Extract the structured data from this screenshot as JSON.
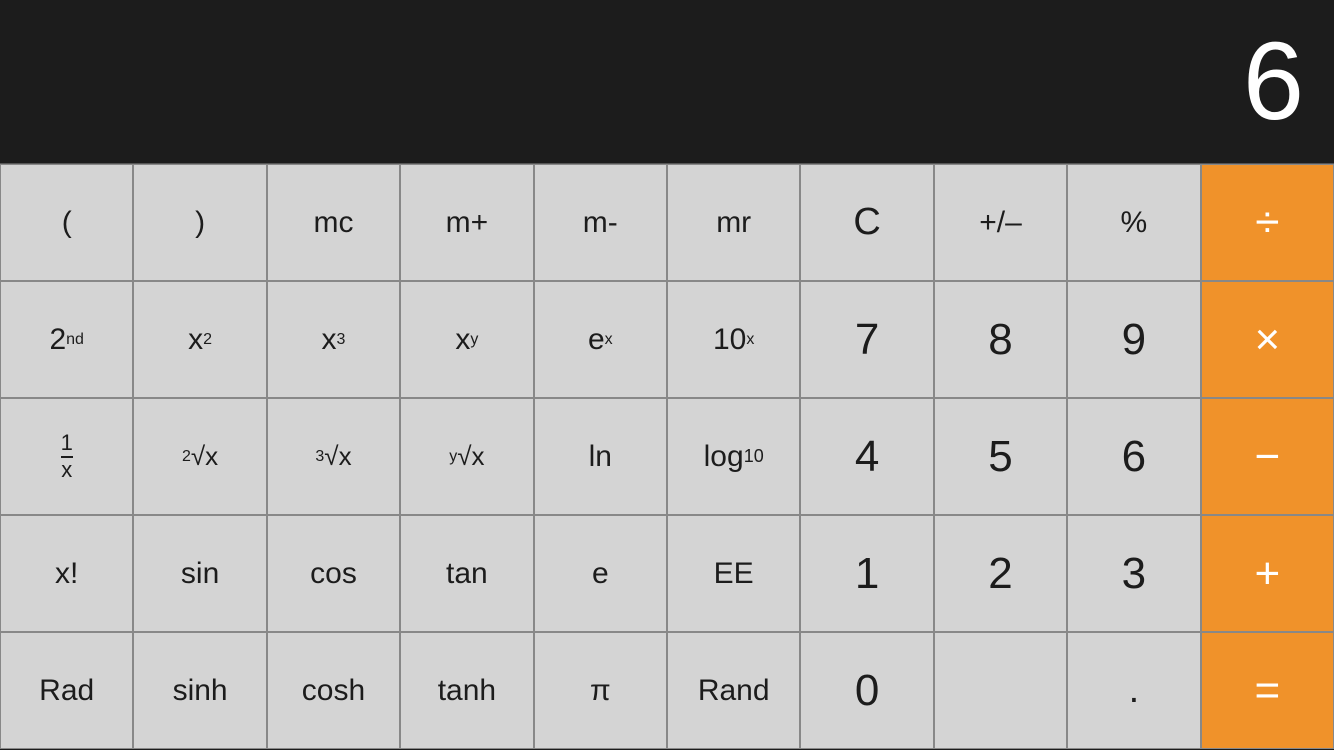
{
  "display": {
    "value": "6"
  },
  "colors": {
    "button_gray": "#d4d4d4",
    "button_orange": "#f0922a",
    "button_dark_gray": "#a8a8a8",
    "display_bg": "#1c1c1c",
    "text_dark": "#1c1c1c",
    "text_white": "#ffffff"
  },
  "rows": [
    [
      {
        "id": "open-paren",
        "label": "(",
        "type": "gray"
      },
      {
        "id": "close-paren",
        "label": ")",
        "type": "gray"
      },
      {
        "id": "mc",
        "label": "mc",
        "type": "gray"
      },
      {
        "id": "mplus",
        "label": "m+",
        "type": "gray"
      },
      {
        "id": "mminus",
        "label": "m-",
        "type": "gray"
      },
      {
        "id": "mr",
        "label": "mr",
        "type": "gray"
      },
      {
        "id": "clear",
        "label": "C",
        "type": "gray"
      },
      {
        "id": "plusminus",
        "label": "+/–",
        "type": "gray"
      },
      {
        "id": "percent",
        "label": "%",
        "type": "gray"
      },
      {
        "id": "divide",
        "label": "÷",
        "type": "orange"
      }
    ],
    [
      {
        "id": "2nd",
        "label": "2nd",
        "type": "gray",
        "special": "2nd"
      },
      {
        "id": "x2",
        "label": "x²",
        "type": "gray",
        "special": "x2"
      },
      {
        "id": "x3",
        "label": "x³",
        "type": "gray",
        "special": "x3"
      },
      {
        "id": "xy",
        "label": "xʸ",
        "type": "gray",
        "special": "xy"
      },
      {
        "id": "ex",
        "label": "eˣ",
        "type": "gray",
        "special": "ex"
      },
      {
        "id": "10x",
        "label": "10ˣ",
        "type": "gray",
        "special": "10x"
      },
      {
        "id": "7",
        "label": "7",
        "type": "gray"
      },
      {
        "id": "8",
        "label": "8",
        "type": "gray"
      },
      {
        "id": "9",
        "label": "9",
        "type": "gray"
      },
      {
        "id": "multiply",
        "label": "×",
        "type": "orange"
      }
    ],
    [
      {
        "id": "1x",
        "label": "1/x",
        "type": "gray",
        "special": "fraction"
      },
      {
        "id": "sqrt2",
        "label": "²√x",
        "type": "gray",
        "special": "sqrt2"
      },
      {
        "id": "sqrt3",
        "label": "³√x",
        "type": "gray",
        "special": "sqrt3"
      },
      {
        "id": "sqrty",
        "label": "ʸ√x",
        "type": "gray",
        "special": "sqrty"
      },
      {
        "id": "ln",
        "label": "ln",
        "type": "gray"
      },
      {
        "id": "log10",
        "label": "log₁₀",
        "type": "gray",
        "special": "log10"
      },
      {
        "id": "4",
        "label": "4",
        "type": "gray"
      },
      {
        "id": "5",
        "label": "5",
        "type": "gray"
      },
      {
        "id": "6",
        "label": "6",
        "type": "gray"
      },
      {
        "id": "subtract",
        "label": "−",
        "type": "orange"
      }
    ],
    [
      {
        "id": "factorial",
        "label": "x!",
        "type": "gray"
      },
      {
        "id": "sin",
        "label": "sin",
        "type": "gray"
      },
      {
        "id": "cos",
        "label": "cos",
        "type": "gray"
      },
      {
        "id": "tan",
        "label": "tan",
        "type": "gray"
      },
      {
        "id": "e",
        "label": "e",
        "type": "gray"
      },
      {
        "id": "EE",
        "label": "EE",
        "type": "gray"
      },
      {
        "id": "1",
        "label": "1",
        "type": "gray"
      },
      {
        "id": "2",
        "label": "2",
        "type": "gray"
      },
      {
        "id": "3",
        "label": "3",
        "type": "gray"
      },
      {
        "id": "add",
        "label": "+",
        "type": "orange"
      }
    ],
    [
      {
        "id": "rad",
        "label": "Rad",
        "type": "gray"
      },
      {
        "id": "sinh",
        "label": "sinh",
        "type": "gray"
      },
      {
        "id": "cosh",
        "label": "cosh",
        "type": "gray"
      },
      {
        "id": "tanh",
        "label": "tanh",
        "type": "gray"
      },
      {
        "id": "pi",
        "label": "π",
        "type": "gray"
      },
      {
        "id": "rand",
        "label": "Rand",
        "type": "gray"
      },
      {
        "id": "0",
        "label": "0",
        "type": "gray"
      },
      {
        "id": "empty1",
        "label": "",
        "type": "gray"
      },
      {
        "id": "dot",
        "label": ".",
        "type": "gray"
      },
      {
        "id": "equals",
        "label": "=",
        "type": "orange"
      }
    ]
  ]
}
